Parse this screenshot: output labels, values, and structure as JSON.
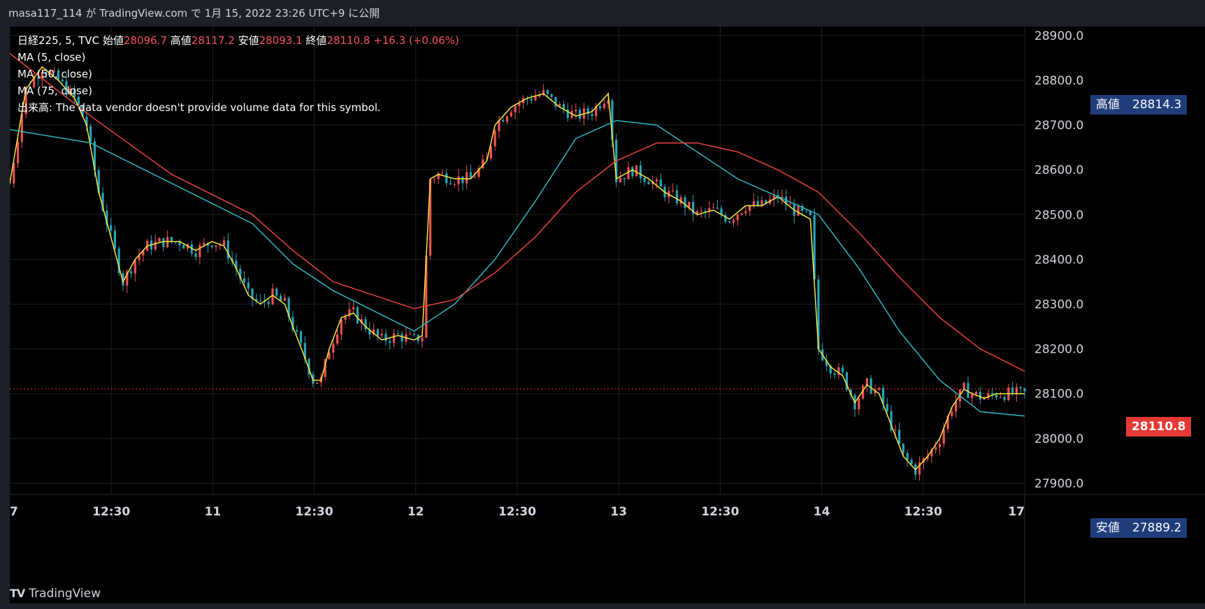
{
  "header": {
    "attribution": "masa117_114 が TradingView.com で 1月 15, 2022 23:26 UTC+9 に公開"
  },
  "legend": {
    "symbol": "日経225, 5, TVC",
    "open_label": "始値",
    "open": "28096.7",
    "high_label": "高値",
    "high": "28117.2",
    "low_label": "安値",
    "low": "28093.1",
    "close_label": "終値",
    "close": "28110.8",
    "change": "+16.3 (+0.06%)",
    "ma5": "MA (5, close)",
    "ma50": "MA (50, close)",
    "ma75": "MA (75, close)",
    "volume": "出来高: The data vendor doesn't provide volume data for this symbol."
  },
  "footer": {
    "brand": "TradingView",
    "logo_mark": "TV"
  },
  "badges": {
    "high_label": "高値",
    "high_value": "28814.3",
    "low_label": "安値",
    "low_value": "27889.2",
    "last_value": "28110.8"
  },
  "colors": {
    "background": "#000000",
    "chrome": "#1e2029",
    "grid": "#1c1f28",
    "up": "#ef5350",
    "down": "#26a6b8",
    "ma5": "#f5e642",
    "ma50": "#2bb6c6",
    "ma75": "#e8423f",
    "high_badge": "#1f3d7a",
    "last_badge": "#e53935"
  },
  "chart_data": {
    "type": "line",
    "title": "日経225, 5, TVC",
    "x_ticks": [
      "7",
      "12:30",
      "11",
      "12:30",
      "12",
      "12:30",
      "13",
      "12:30",
      "14",
      "12:30",
      "17"
    ],
    "y_ticks": [
      "27900.0",
      "28000.0",
      "28100.0",
      "28200.0",
      "28300.0",
      "28400.0",
      "28500.0",
      "28600.0",
      "28700.0",
      "28800.0",
      "28900.0"
    ],
    "ylim": [
      27875,
      28920
    ],
    "last_price": 28110.8,
    "series": [
      {
        "name": "MA (5, close)",
        "points": [
          [
            0,
            28570
          ],
          [
            4,
            28780
          ],
          [
            8,
            28830
          ],
          [
            12,
            28800
          ],
          [
            16,
            28760
          ],
          [
            19,
            28700
          ],
          [
            22,
            28550
          ],
          [
            25,
            28450
          ],
          [
            28,
            28350
          ],
          [
            31,
            28400
          ],
          [
            34,
            28430
          ],
          [
            38,
            28440
          ],
          [
            42,
            28440
          ],
          [
            46,
            28420
          ],
          [
            50,
            28440
          ],
          [
            53,
            28430
          ],
          [
            56,
            28380
          ],
          [
            59,
            28320
          ],
          [
            62,
            28300
          ],
          [
            65,
            28320
          ],
          [
            68,
            28300
          ],
          [
            70,
            28250
          ],
          [
            73,
            28180
          ],
          [
            75,
            28130
          ],
          [
            77,
            28130
          ],
          [
            79,
            28200
          ],
          [
            82,
            28270
          ],
          [
            85,
            28280
          ],
          [
            88,
            28250
          ],
          [
            92,
            28220
          ],
          [
            96,
            28230
          ],
          [
            100,
            28220
          ],
          [
            102,
            28230
          ],
          [
            104,
            28580
          ],
          [
            106,
            28590
          ],
          [
            110,
            28580
          ],
          [
            114,
            28580
          ],
          [
            118,
            28620
          ],
          [
            120,
            28700
          ],
          [
            124,
            28740
          ],
          [
            128,
            28760
          ],
          [
            132,
            28770
          ],
          [
            136,
            28740
          ],
          [
            140,
            28720
          ],
          [
            144,
            28730
          ],
          [
            148,
            28770
          ],
          [
            150,
            28580
          ],
          [
            154,
            28600
          ],
          [
            158,
            28580
          ],
          [
            162,
            28550
          ],
          [
            166,
            28530
          ],
          [
            170,
            28500
          ],
          [
            174,
            28510
          ],
          [
            178,
            28490
          ],
          [
            182,
            28520
          ],
          [
            186,
            28520
          ],
          [
            190,
            28540
          ],
          [
            194,
            28510
          ],
          [
            198,
            28490
          ],
          [
            200,
            28200
          ],
          [
            203,
            28160
          ],
          [
            206,
            28140
          ],
          [
            209,
            28080
          ],
          [
            212,
            28120
          ],
          [
            215,
            28100
          ],
          [
            218,
            28030
          ],
          [
            221,
            27960
          ],
          [
            224,
            27930
          ],
          [
            227,
            27960
          ],
          [
            230,
            28000
          ],
          [
            233,
            28070
          ],
          [
            236,
            28110
          ],
          [
            238,
            28100
          ],
          [
            241,
            28090
          ],
          [
            244,
            28100
          ],
          [
            248,
            28100
          ],
          [
            251,
            28100
          ]
        ]
      },
      {
        "name": "MA (50, close)",
        "points": [
          [
            0,
            28690
          ],
          [
            20,
            28660
          ],
          [
            40,
            28570
          ],
          [
            60,
            28480
          ],
          [
            70,
            28390
          ],
          [
            80,
            28330
          ],
          [
            100,
            28240
          ],
          [
            110,
            28300
          ],
          [
            120,
            28400
          ],
          [
            130,
            28530
          ],
          [
            140,
            28670
          ],
          [
            150,
            28710
          ],
          [
            160,
            28700
          ],
          [
            170,
            28640
          ],
          [
            180,
            28580
          ],
          [
            190,
            28540
          ],
          [
            200,
            28500
          ],
          [
            210,
            28380
          ],
          [
            220,
            28240
          ],
          [
            230,
            28130
          ],
          [
            240,
            28060
          ],
          [
            251,
            28050
          ]
        ]
      },
      {
        "name": "MA (75, close)",
        "points": [
          [
            0,
            28860
          ],
          [
            20,
            28720
          ],
          [
            40,
            28590
          ],
          [
            60,
            28500
          ],
          [
            70,
            28420
          ],
          [
            80,
            28350
          ],
          [
            100,
            28290
          ],
          [
            110,
            28310
          ],
          [
            120,
            28370
          ],
          [
            130,
            28450
          ],
          [
            140,
            28550
          ],
          [
            150,
            28620
          ],
          [
            160,
            28660
          ],
          [
            170,
            28660
          ],
          [
            180,
            28640
          ],
          [
            190,
            28600
          ],
          [
            200,
            28550
          ],
          [
            210,
            28460
          ],
          [
            220,
            28360
          ],
          [
            230,
            28270
          ],
          [
            240,
            28200
          ],
          [
            251,
            28150
          ]
        ]
      }
    ]
  }
}
